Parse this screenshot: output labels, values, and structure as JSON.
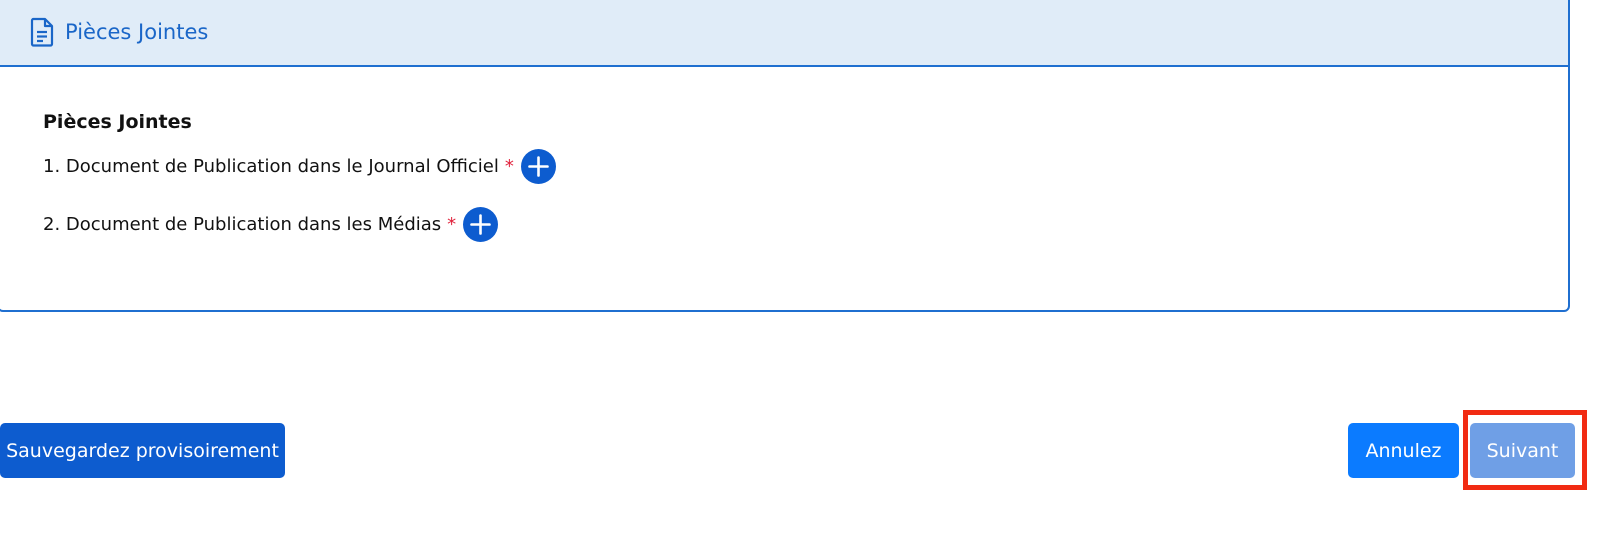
{
  "header": {
    "title": "Pièces Jointes",
    "icon": "document-icon"
  },
  "section": {
    "title": "Pièces Jointes",
    "items": [
      {
        "label": "1. Document de Publication dans le Journal Officiel",
        "required": "*"
      },
      {
        "label": "2. Document de Publication dans les Médias",
        "required": "*"
      }
    ]
  },
  "actions": {
    "save_label": "Sauvegardez provisoirement",
    "cancel_label": "Annulez",
    "next_label": "Suivant"
  },
  "colors": {
    "accent": "#1f6fd0",
    "header_bg": "#e0ecf8",
    "primary_button": "#0d5ccf",
    "cancel_button": "#0b7bff",
    "next_button": "#6f9fe6",
    "required": "#e0213b",
    "highlight": "#f12b13"
  }
}
